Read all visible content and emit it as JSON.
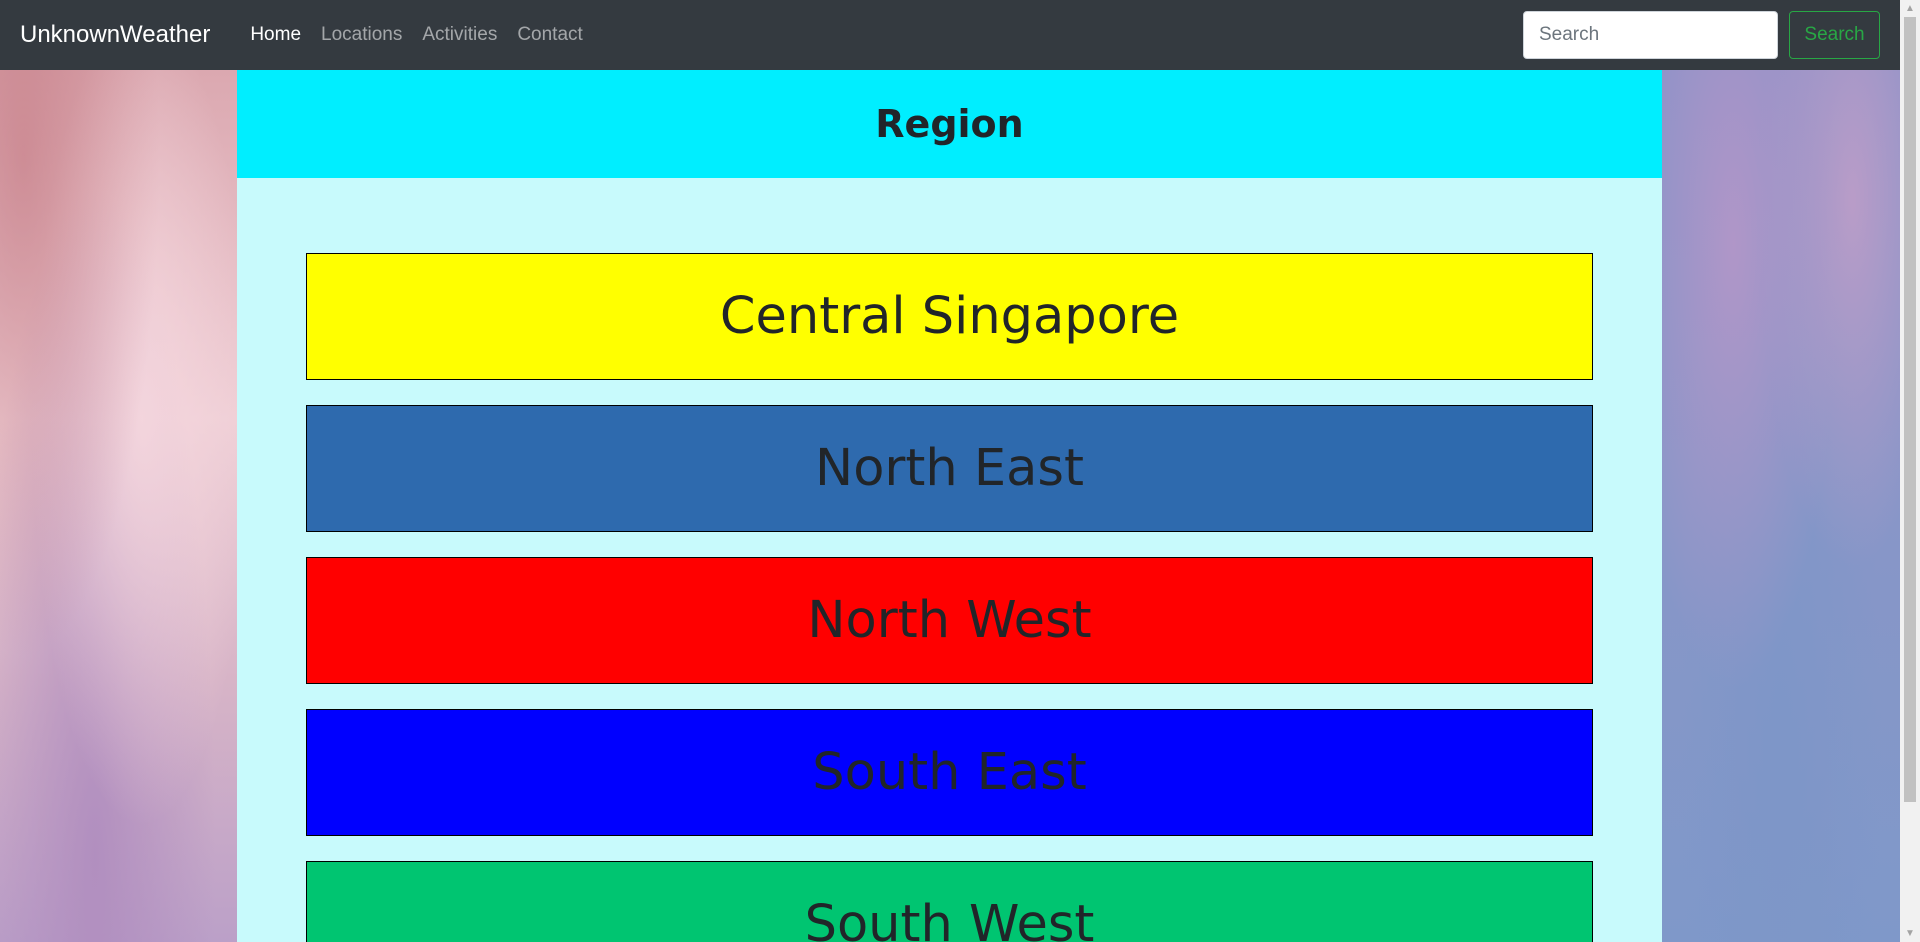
{
  "navbar": {
    "brand": "UnknownWeather",
    "links": [
      {
        "label": "Home",
        "active": true
      },
      {
        "label": "Locations",
        "active": false
      },
      {
        "label": "Activities",
        "active": false
      },
      {
        "label": "Contact",
        "active": false
      }
    ],
    "search_placeholder": "Search",
    "search_value": "",
    "search_button": "Search"
  },
  "page": {
    "title": "Region"
  },
  "regions": [
    {
      "label": "Central Singapore",
      "color": "#ffff00"
    },
    {
      "label": "North East",
      "color": "#2e6aae"
    },
    {
      "label": "North West",
      "color": "#ff0000"
    },
    {
      "label": "South East",
      "color": "#0000ff"
    },
    {
      "label": "South West",
      "color": "#00c571"
    }
  ],
  "colors": {
    "navbar_bg": "#343a40",
    "header_bg": "#00eeff",
    "content_bg": "#c8fafc",
    "search_button": "#28a745"
  }
}
